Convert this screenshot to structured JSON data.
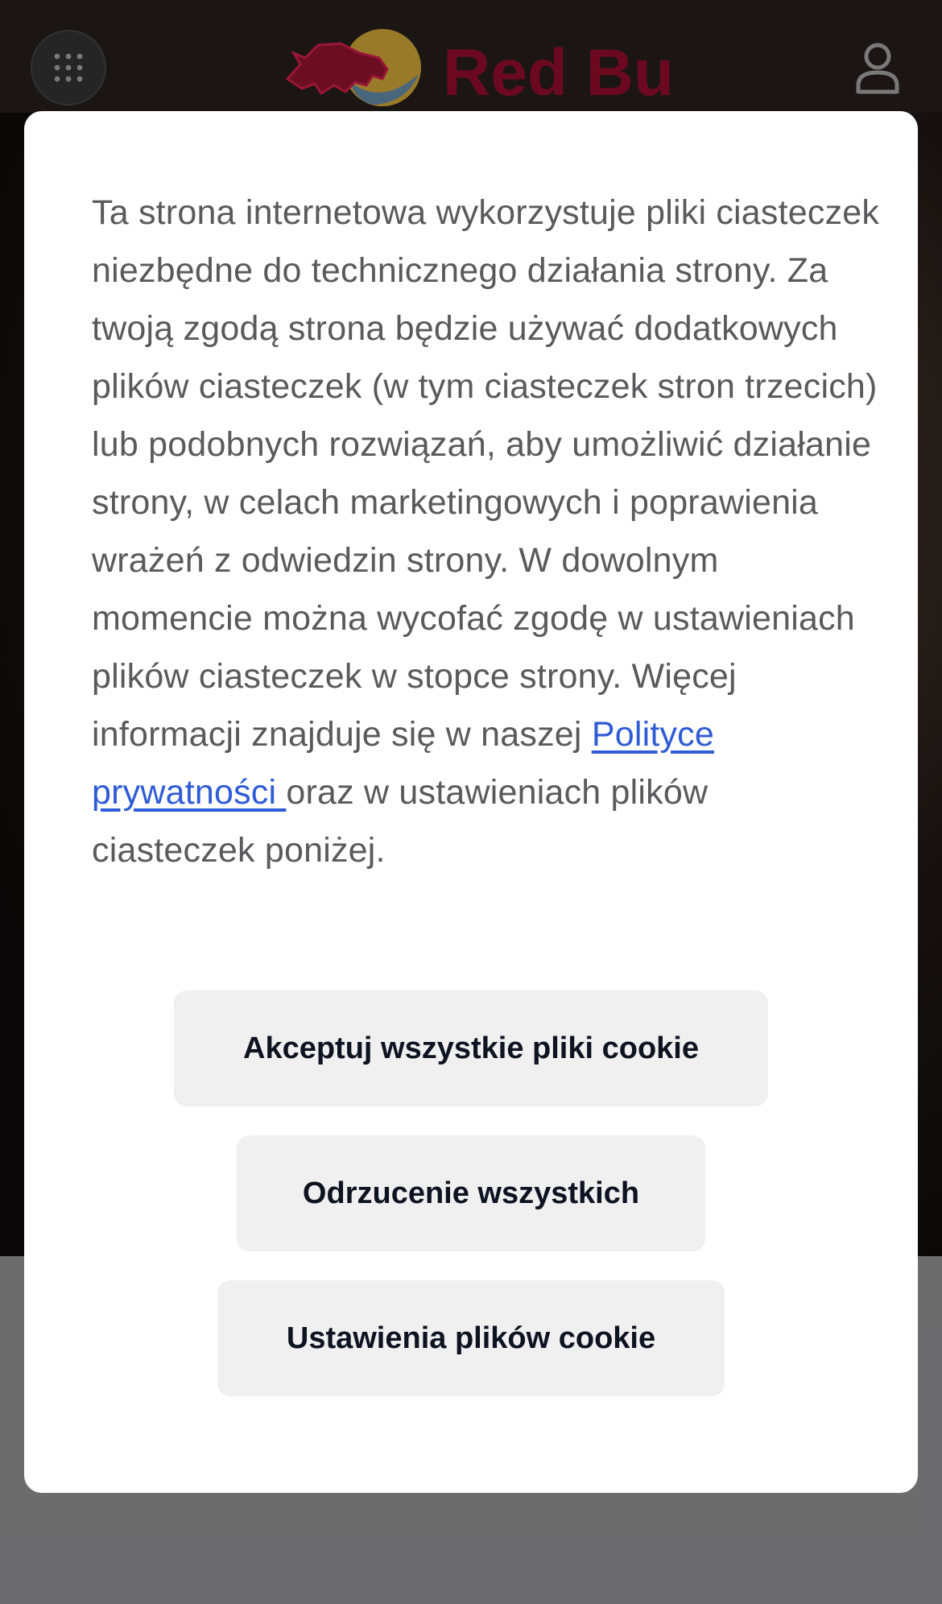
{
  "header": {
    "logo_text": "Red Bull",
    "brand_color": "#8e0b2c",
    "menu_icon": "grid-dots-icon",
    "user_icon": "user-icon"
  },
  "consent": {
    "text_before_link": "Ta strona internetowa wykorzystuje pliki ciasteczek niezbędne do technicznego działania strony. Za twoją zgodą strona będzie używać dodatkowych plików ciasteczek (w tym ciasteczek stron trzecich) lub podobnych rozwiązań, aby umożliwić działanie strony, w celach marketingowych i poprawienia wrażeń z odwiedzin strony. W dowolnym momencie można wycofać zgodę w ustawieniach plików ciasteczek w stopce strony. Więcej informacji znajduje się w naszej ",
    "link_text": "Polityce prywatności ",
    "text_after_link": "oraz w ustawieniach plików ciasteczek poniżej.",
    "link_color": "#2e5bd6"
  },
  "buttons": {
    "accept_all": "Akceptuj wszystkie pliki cookie",
    "reject_all": "Odrzucenie wszystkich",
    "settings": "Ustawienia plików cookie"
  }
}
